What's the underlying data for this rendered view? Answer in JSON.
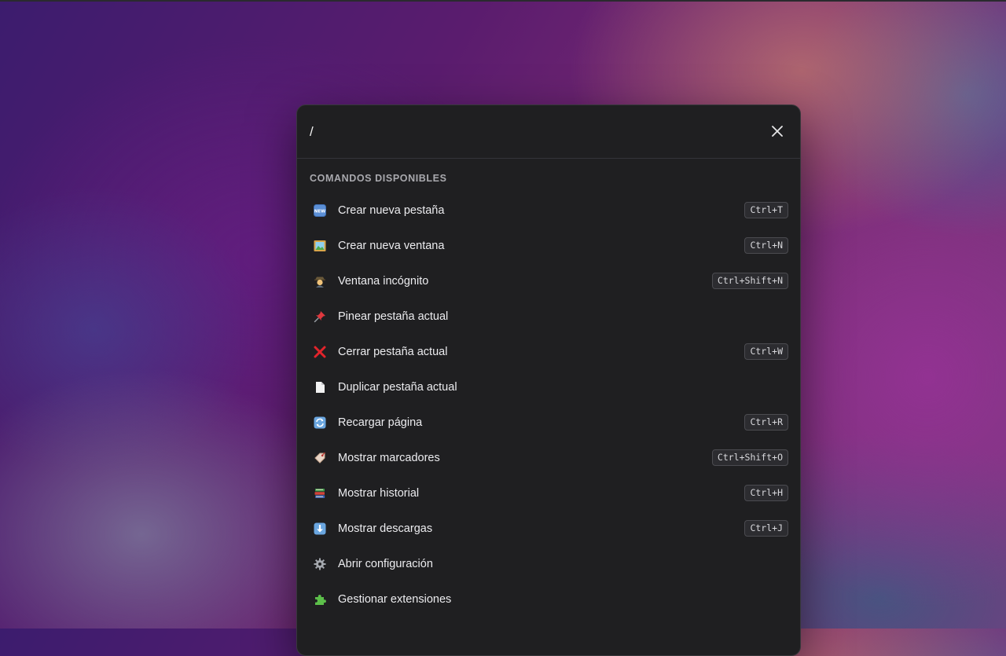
{
  "search": {
    "value": "/",
    "placeholder": ""
  },
  "section_title": "COMANDOS DISPONIBLES",
  "commands": [
    {
      "icon": "new-button-icon",
      "label": "Crear nueva pestaña",
      "shortcut": "Ctrl+T"
    },
    {
      "icon": "framed-picture-icon",
      "label": "Crear nueva ventana",
      "shortcut": "Ctrl+N"
    },
    {
      "icon": "detective-icon",
      "label": "Ventana incógnito",
      "shortcut": "Ctrl+Shift+N"
    },
    {
      "icon": "pushpin-icon",
      "label": "Pinear pestaña actual",
      "shortcut": ""
    },
    {
      "icon": "cross-mark-icon",
      "label": "Cerrar pestaña actual",
      "shortcut": "Ctrl+W"
    },
    {
      "icon": "page-icon",
      "label": "Duplicar pestaña actual",
      "shortcut": ""
    },
    {
      "icon": "reload-icon",
      "label": "Recargar página",
      "shortcut": "Ctrl+R"
    },
    {
      "icon": "bookmark-tag-icon",
      "label": "Mostrar marcadores",
      "shortcut": "Ctrl+Shift+O"
    },
    {
      "icon": "books-icon",
      "label": "Mostrar historial",
      "shortcut": "Ctrl+H"
    },
    {
      "icon": "down-arrow-icon",
      "label": "Mostrar descargas",
      "shortcut": "Ctrl+J"
    },
    {
      "icon": "gear-icon",
      "label": "Abrir configuración",
      "shortcut": ""
    },
    {
      "icon": "puzzle-icon",
      "label": "Gestionar extensiones",
      "shortcut": ""
    }
  ],
  "colors": {
    "palette_bg": "#1f1f21",
    "text": "#ececef",
    "section_title": "#a9a9ae",
    "kbd_bg": "#2c2c30"
  }
}
